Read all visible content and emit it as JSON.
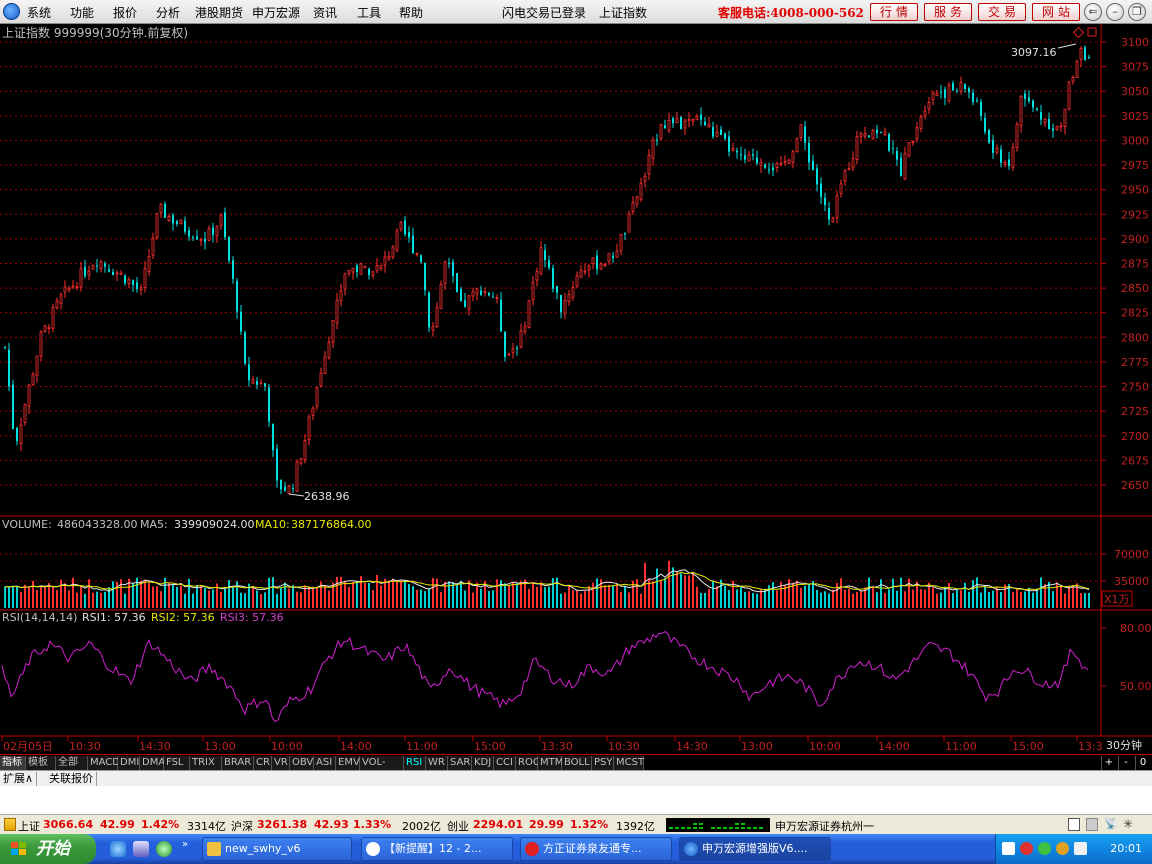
{
  "menu": {
    "items": [
      "系统",
      "功能",
      "报价",
      "分析",
      "港股期货",
      "申万宏源",
      "资讯",
      "工具",
      "帮助"
    ],
    "flash_login": "闪电交易已登录",
    "index_name": "上证指数",
    "hotline": "客服电话:4008-000-562",
    "nav_buttons": [
      "行情",
      "服务",
      "交易",
      "网站"
    ]
  },
  "chart": {
    "title": "上证指数 999999(30分钟.前复权)",
    "high_label": "3097.16",
    "low_label": "2638.96",
    "price_axis": [
      "3100",
      "3075",
      "3050",
      "3025",
      "3000",
      "2975",
      "2950",
      "2925",
      "2900",
      "2875",
      "2850",
      "2825",
      "2800",
      "2775",
      "2750",
      "2725",
      "2700",
      "2675",
      "2650"
    ],
    "volume": {
      "label": "VOLUME:",
      "value": "486043328.00",
      "ma5_label": "MA5:",
      "ma5_value": "339909024.00",
      "ma10_label": "MA10:",
      "ma10_value": "387176864.00",
      "axis": [
        "70000",
        "35000"
      ],
      "unit": "X1万"
    },
    "rsi": {
      "label": "RSI(14,14,14)",
      "rsi1": "RSI1: 57.36",
      "rsi2": "RSI2: 57.36",
      "rsi3": "RSI3: 57.36",
      "axis": [
        "80.00",
        "50.00"
      ]
    },
    "time_axis": [
      "02月05日",
      "10:30",
      "14:30",
      "13:00",
      "10:00",
      "14:00",
      "11:00",
      "15:00",
      "13:30",
      "10:30",
      "14:30",
      "13:00",
      "10:00",
      "14:00",
      "11:00",
      "15:00",
      "13:3"
    ],
    "period": "30分钟"
  },
  "tabs": [
    "指标",
    "模板",
    "全部",
    "MACD",
    "DMI",
    "DMA",
    "FSL",
    "TRIX",
    "BRAR",
    "CR",
    "VR",
    "OBV",
    "ASI",
    "EMV",
    "VOL-TDX",
    "RSI",
    "WR",
    "SAR",
    "KDJ",
    "CCI",
    "ROC",
    "MTM",
    "BOLL",
    "PSY",
    "MCST"
  ],
  "active_tab": "RSI",
  "tab_controls": [
    "+",
    "-",
    "0"
  ],
  "ext": [
    "扩展∧",
    "关联报价"
  ],
  "status": {
    "sh_label": "上证",
    "sh_price": "3066.64",
    "sh_change": "42.99",
    "sh_pct": "1.42%",
    "sh_amount": "3314亿",
    "hs_label": "沪深",
    "hs_price": "3261.38",
    "hs_change": "42.93",
    "hs_pct": "1.33%",
    "hs_amount": "2002亿",
    "cy_label": "创业",
    "cy_price": "2294.01",
    "cy_change": "29.99",
    "cy_pct": "1.32%",
    "cy_amount": "1392亿",
    "broker": "申万宏源证券杭州一"
  },
  "taskbar": {
    "start": "开始",
    "tasks": [
      "new_swhy_v6",
      "【新提醒】12 - 2...",
      "方正证券泉友通专...",
      "申万宏源增强版V6...."
    ],
    "clock": "20:01"
  }
}
